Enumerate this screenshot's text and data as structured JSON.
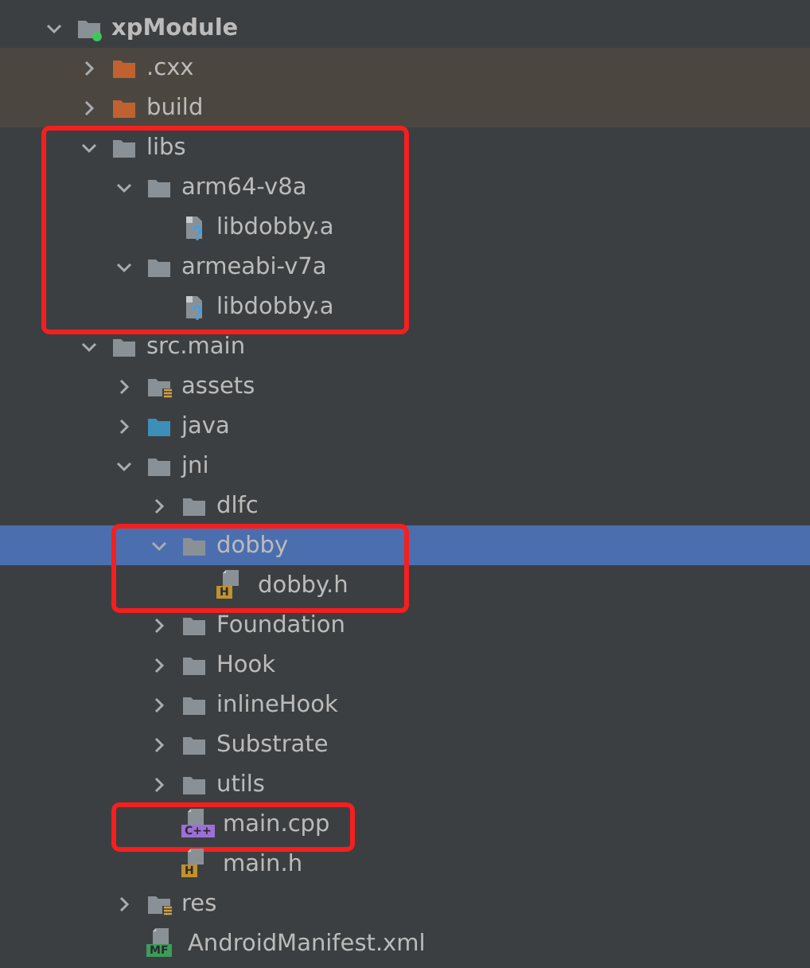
{
  "tree": [
    {
      "label": "xpModule",
      "kind": "module",
      "expanded": true,
      "selected": false,
      "excluded": false,
      "boxed": false,
      "children": [
        {
          "label": ".cxx",
          "kind": "folder",
          "expanded": false,
          "selected": false,
          "excluded": true,
          "boxed": false
        },
        {
          "label": "build",
          "kind": "folder",
          "expanded": false,
          "selected": false,
          "excluded": true,
          "boxed": false
        },
        {
          "label": "libs",
          "kind": "folder",
          "expanded": true,
          "selected": false,
          "excluded": false,
          "boxed": true,
          "children": [
            {
              "label": "arm64-v8a",
              "kind": "folder",
              "expanded": true,
              "selected": false,
              "excluded": false,
              "boxed": false,
              "children": [
                {
                  "label": "libdobby.a",
                  "kind": "unknown-file",
                  "selected": false,
                  "excluded": false,
                  "boxed": false
                }
              ]
            },
            {
              "label": "armeabi-v7a",
              "kind": "folder",
              "expanded": true,
              "selected": false,
              "excluded": false,
              "boxed": false,
              "children": [
                {
                  "label": "libdobby.a",
                  "kind": "unknown-file",
                  "selected": false,
                  "excluded": false,
                  "boxed": false
                }
              ]
            }
          ]
        },
        {
          "label": "src.main",
          "kind": "folder",
          "expanded": true,
          "selected": false,
          "excluded": false,
          "boxed": false,
          "children": [
            {
              "label": "assets",
              "kind": "resource-folder",
              "expanded": false,
              "selected": false,
              "excluded": false,
              "boxed": false
            },
            {
              "label": "java",
              "kind": "source-folder",
              "expanded": false,
              "selected": false,
              "excluded": false,
              "boxed": false
            },
            {
              "label": "jni",
              "kind": "folder",
              "expanded": true,
              "selected": false,
              "excluded": false,
              "boxed": false,
              "children": [
                {
                  "label": "dlfc",
                  "kind": "folder",
                  "expanded": false,
                  "selected": false,
                  "excluded": false,
                  "boxed": false
                },
                {
                  "label": "dobby",
                  "kind": "folder",
                  "expanded": true,
                  "selected": true,
                  "excluded": false,
                  "boxed": true,
                  "children": [
                    {
                      "label": "dobby.h",
                      "kind": "badge-file",
                      "badge": "H",
                      "color": "#c0922d",
                      "selected": false,
                      "excluded": false,
                      "boxed": false
                    }
                  ]
                },
                {
                  "label": "Foundation",
                  "kind": "folder",
                  "expanded": false,
                  "selected": false,
                  "excluded": false,
                  "boxed": false
                },
                {
                  "label": "Hook",
                  "kind": "folder",
                  "expanded": false,
                  "selected": false,
                  "excluded": false,
                  "boxed": false
                },
                {
                  "label": "inlineHook",
                  "kind": "folder",
                  "expanded": false,
                  "selected": false,
                  "excluded": false,
                  "boxed": false
                },
                {
                  "label": "Substrate",
                  "kind": "folder",
                  "expanded": false,
                  "selected": false,
                  "excluded": false,
                  "boxed": false
                },
                {
                  "label": "utils",
                  "kind": "folder",
                  "expanded": false,
                  "selected": false,
                  "excluded": false,
                  "boxed": false
                },
                {
                  "label": "main.cpp",
                  "kind": "badge-file",
                  "badge": "C++",
                  "color": "#9c6fd6",
                  "selected": false,
                  "excluded": false,
                  "boxed": true
                },
                {
                  "label": "main.h",
                  "kind": "badge-file",
                  "badge": "H",
                  "color": "#c0922d",
                  "selected": false,
                  "excluded": false,
                  "boxed": false
                }
              ]
            },
            {
              "label": "res",
              "kind": "resource-folder",
              "expanded": false,
              "selected": false,
              "excluded": false,
              "boxed": false
            },
            {
              "label": "AndroidManifest.xml",
              "kind": "badge-file",
              "badge": "MF",
              "color": "#3d9c5c",
              "selected": false,
              "excluded": false,
              "boxed": false
            }
          ]
        }
      ]
    }
  ]
}
